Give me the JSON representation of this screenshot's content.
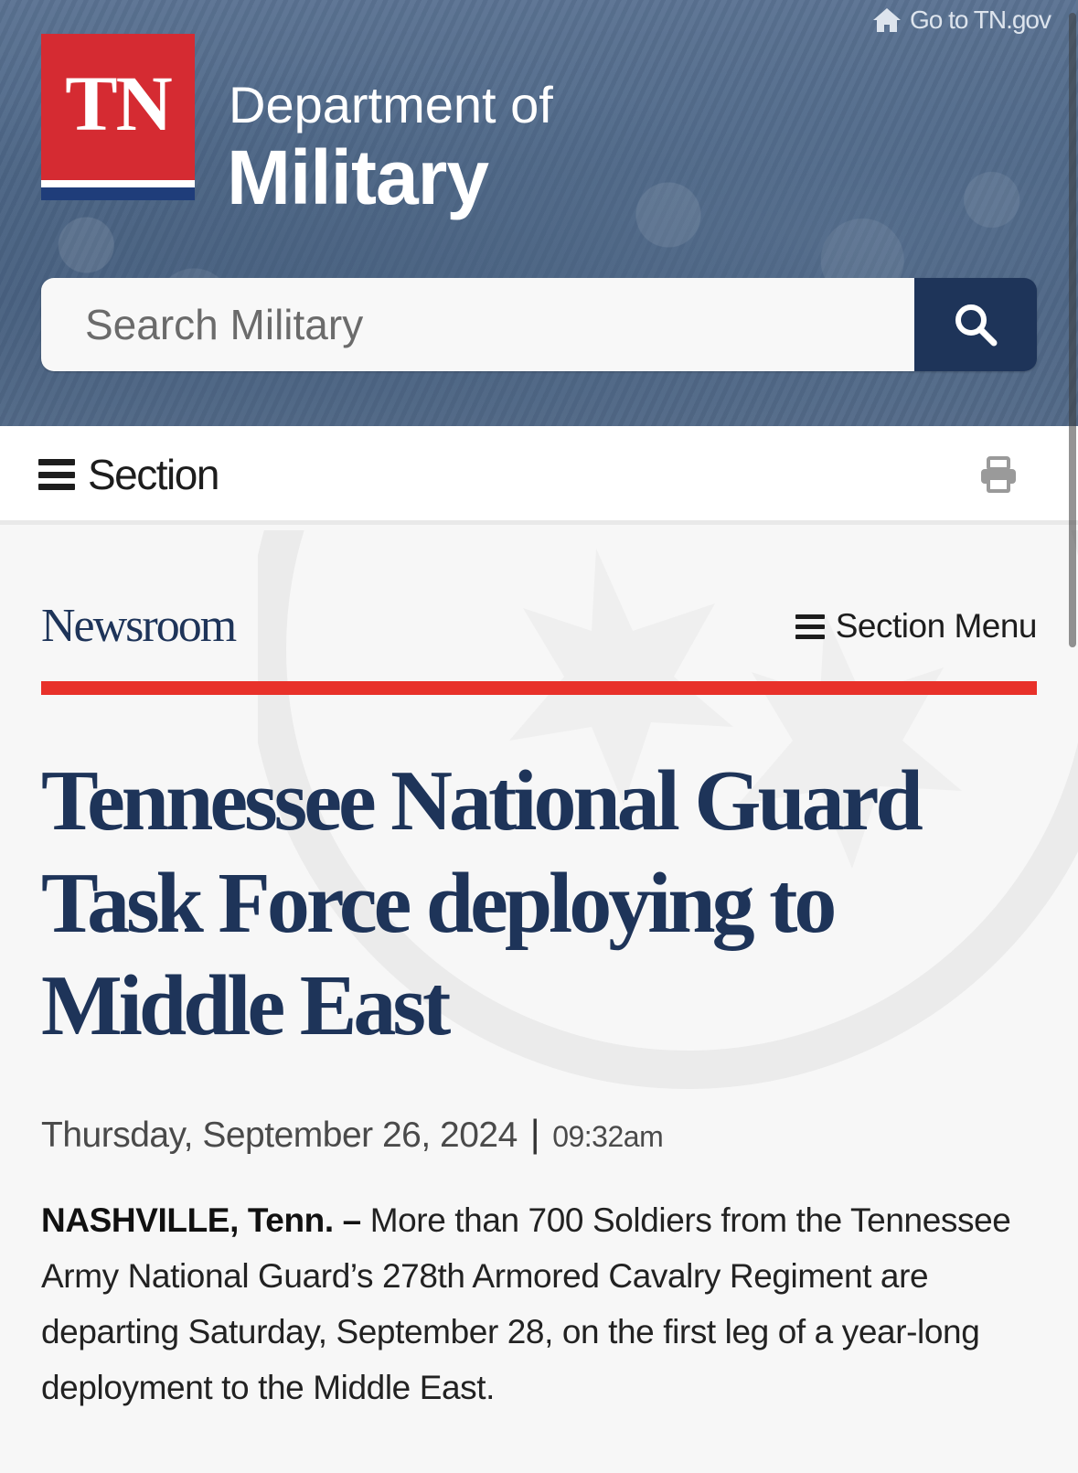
{
  "header": {
    "goto_label": "Go to TN.gov",
    "logo_text": "TN",
    "dept_line1": "Department of",
    "dept_line2": "Military"
  },
  "search": {
    "placeholder": "Search Military"
  },
  "section_bar": {
    "label": "Section"
  },
  "newsroom": {
    "title": "Newsroom",
    "menu_label": "Section Menu"
  },
  "article": {
    "headline": "Tennessee National Guard Task Force deploying to Middle East",
    "date": "Thursday, September 26, 2024",
    "separator": "|",
    "time": "09:32am",
    "lead_bold": "NASHVILLE, Tenn. –",
    "lead_text": " More than 700 Soldiers from the Tennessee Army National Guard’s 278th Armored Cavalry Regiment are departing Saturday, September 28, on the first leg of a year-long deployment to the Middle East."
  },
  "colors": {
    "brand_navy": "#1e3459",
    "logo_red": "#d52b32",
    "accent_red": "#e8312a"
  },
  "icons": {
    "home": "home-icon",
    "search": "search-icon",
    "menu": "hamburger-icon",
    "print": "print-icon"
  }
}
